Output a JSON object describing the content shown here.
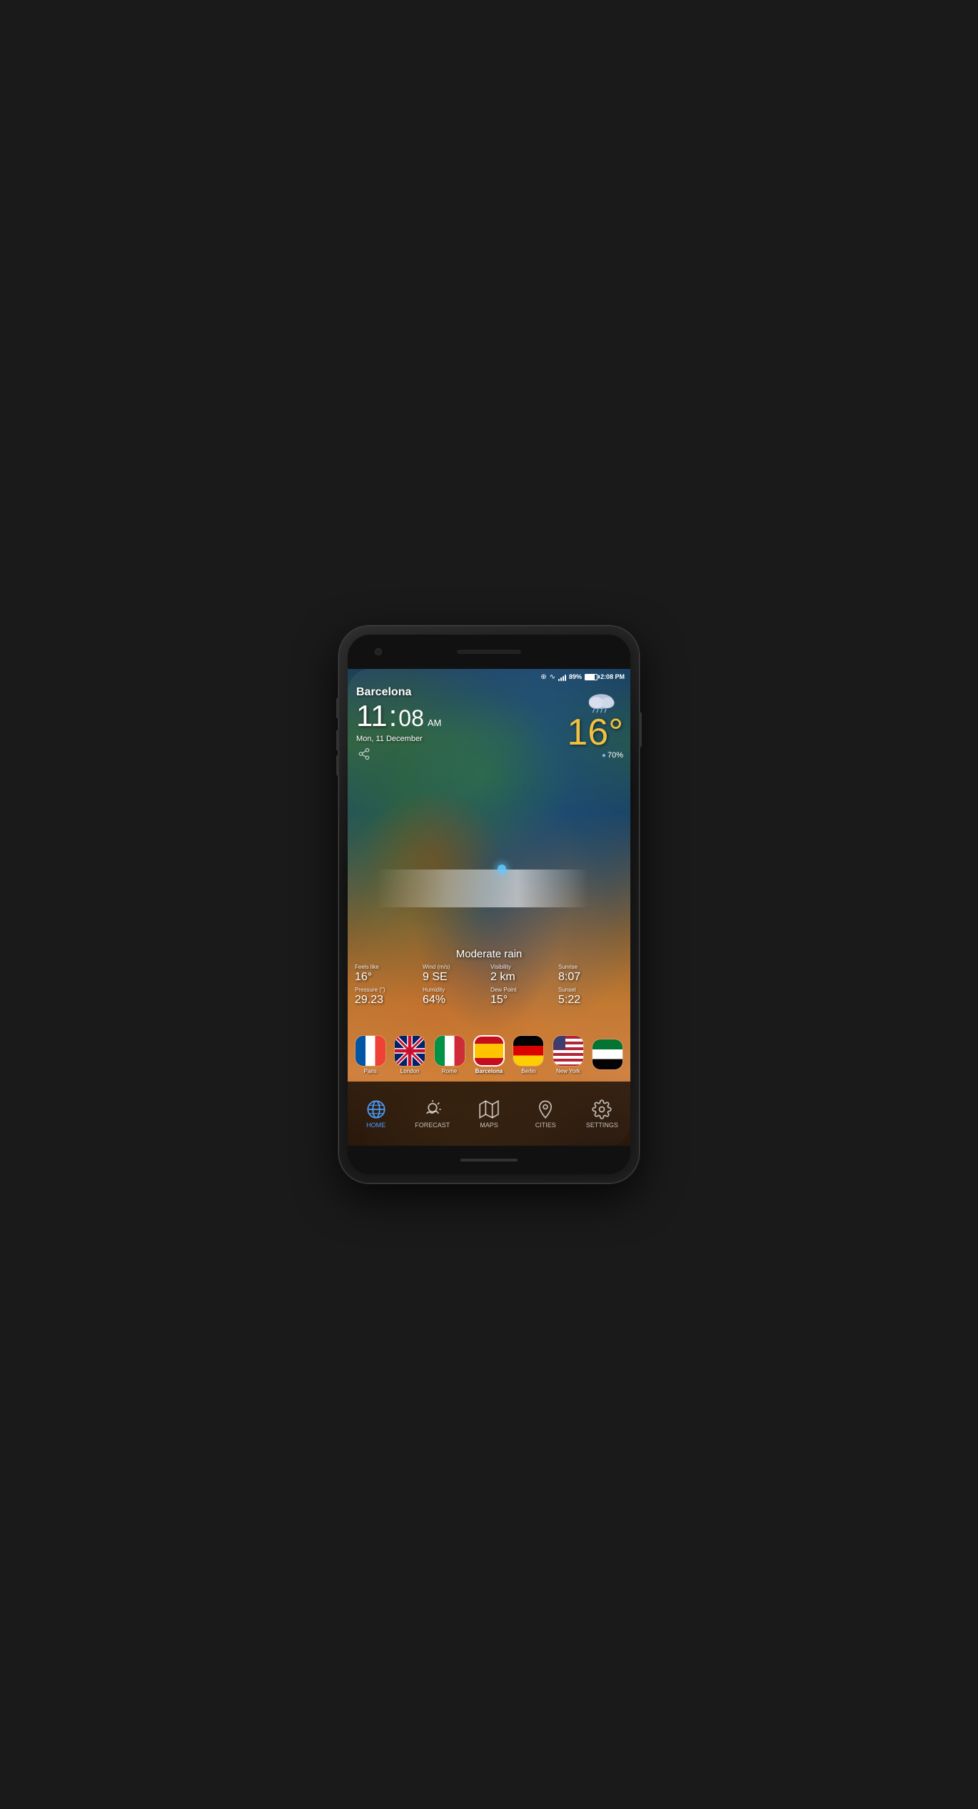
{
  "phone": {
    "statusBar": {
      "battery": "89%",
      "time": "2:08 PM",
      "batteryIcon": "battery-icon"
    },
    "weather": {
      "city": "Barcelona",
      "time": "11",
      "minutes": "08",
      "ampm": "AM",
      "date": "Mon, 11 December",
      "temperature": "16°",
      "humidity": "70%",
      "condition": "Moderate rain",
      "feelsLike": {
        "label": "Feels like",
        "value": "16°"
      },
      "wind": {
        "label": "Wind (m/s)",
        "value": "9 SE"
      },
      "visibility": {
        "label": "Visibility",
        "value": "2 km"
      },
      "sunrise": {
        "label": "Sunrise",
        "value": "8:07"
      },
      "pressure": {
        "label": "Pressure (\")",
        "value": "29.23"
      },
      "humidity_stat": {
        "label": "Humidity",
        "value": "64%"
      },
      "dewPoint": {
        "label": "Dew Point",
        "value": "15°"
      },
      "sunset": {
        "label": "Sunset",
        "value": "5:22"
      }
    },
    "cities": [
      {
        "name": "Paris",
        "flag": "france"
      },
      {
        "name": "London",
        "flag": "uk"
      },
      {
        "name": "Rome",
        "flag": "italy"
      },
      {
        "name": "Barcelona",
        "flag": "spain",
        "active": true
      },
      {
        "name": "Berlin",
        "flag": "germany"
      },
      {
        "name": "New York",
        "flag": "usa"
      },
      {
        "name": "",
        "flag": "uae"
      }
    ],
    "nav": [
      {
        "id": "home",
        "label": "HOME",
        "active": true
      },
      {
        "id": "forecast",
        "label": "FORECAST",
        "active": false
      },
      {
        "id": "maps",
        "label": "MAPS",
        "active": false
      },
      {
        "id": "cities",
        "label": "CITIES",
        "active": false
      },
      {
        "id": "settings",
        "label": "SETTINGS",
        "active": false
      }
    ]
  }
}
